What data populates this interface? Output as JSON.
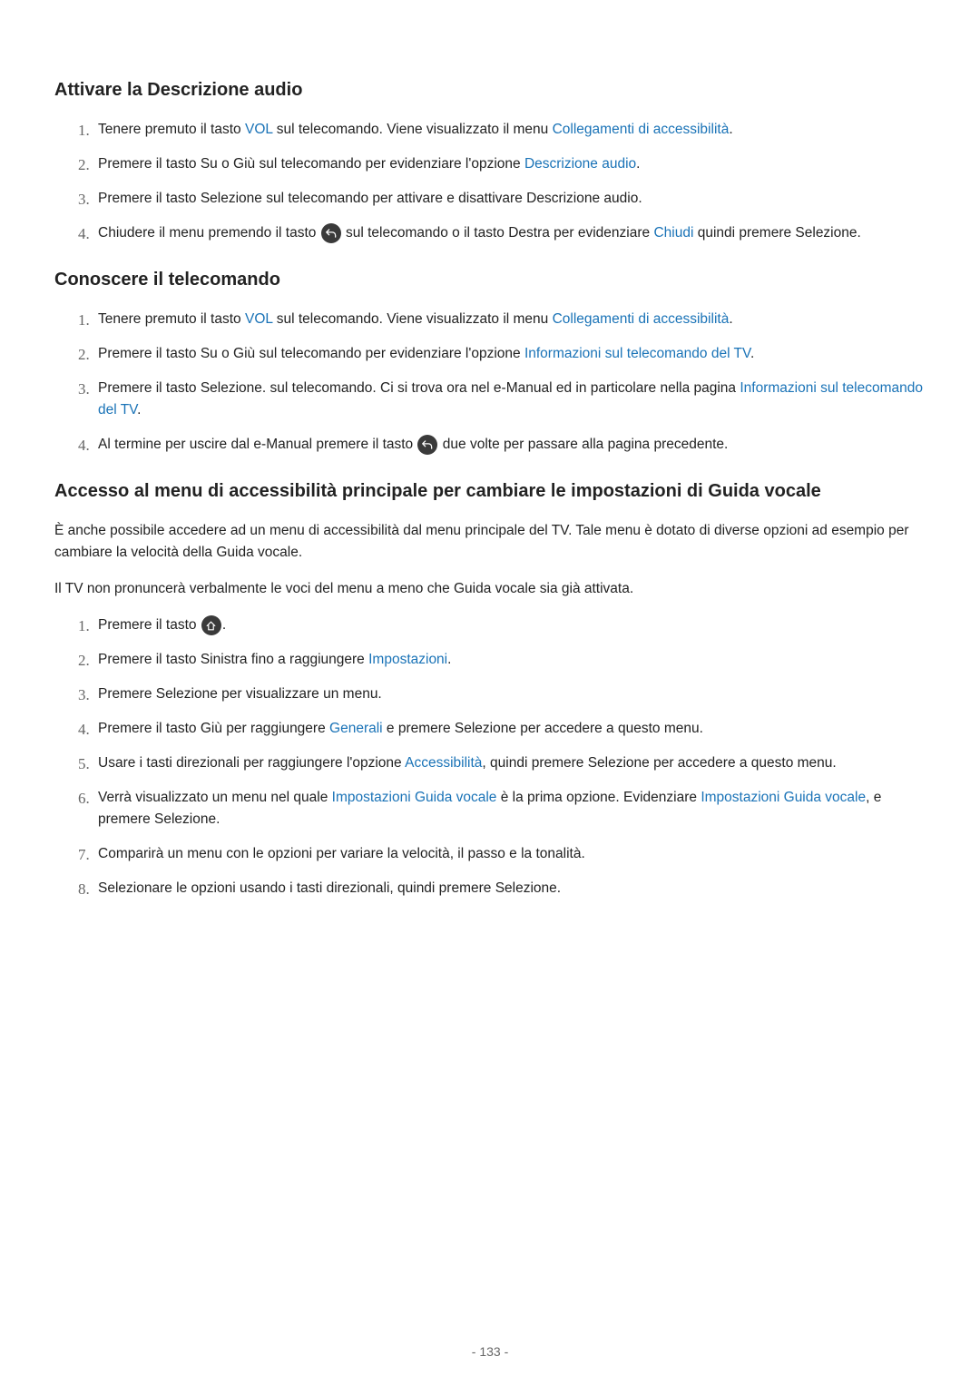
{
  "section1": {
    "title": "Attivare la Descrizione audio",
    "items": [
      {
        "p1a": "Tenere premuto il tasto ",
        "k1": "VOL",
        "p1b": " sul telecomando. Viene visualizzato il menu ",
        "k2": "Collegamenti di accessibilità",
        "p1c": "."
      },
      {
        "p1a": "Premere il tasto Su o Giù sul telecomando per evidenziare l'opzione ",
        "k1": "Descrizione audio",
        "p1b": "."
      },
      {
        "p1a": "Premere il tasto Selezione sul telecomando per attivare e disattivare Descrizione audio."
      },
      {
        "p1a": "Chiudere il menu premendo il tasto ",
        "icon": "back",
        "p1b": " sul telecomando o il tasto Destra per evidenziare ",
        "k1": "Chiudi",
        "p1c": " quindi premere Selezione."
      }
    ]
  },
  "section2": {
    "title": "Conoscere il telecomando",
    "items": [
      {
        "p1a": "Tenere premuto il tasto ",
        "k1": "VOL",
        "p1b": " sul telecomando. Viene visualizzato il menu ",
        "k2": "Collegamenti di accessibilità",
        "p1c": "."
      },
      {
        "p1a": "Premere il tasto Su o Giù sul telecomando per evidenziare l'opzione ",
        "k1": "Informazioni sul telecomando del TV",
        "p1b": "."
      },
      {
        "p1a": "Premere il tasto Selezione. sul telecomando. Ci si trova ora nel e-Manual ed in particolare nella pagina ",
        "k1": "Informazioni sul telecomando del TV",
        "p1b": "."
      },
      {
        "p1a": "Al termine per uscire dal e-Manual premere il tasto ",
        "icon": "back",
        "p1b": " due volte per passare alla pagina precedente."
      }
    ]
  },
  "section3": {
    "title": "Accesso al menu di accessibilità principale per cambiare le impostazioni di Guida vocale",
    "intro1": "È anche possibile accedere ad un menu di accessibilità dal menu principale del TV. Tale menu è dotato di diverse opzioni ad esempio per cambiare la velocità della Guida vocale.",
    "intro2": "Il TV non pronuncerà verbalmente le voci del menu a meno che Guida vocale sia già attivata.",
    "items": [
      {
        "p1a": "Premere il tasto ",
        "icon": "home",
        "p1b": "."
      },
      {
        "p1a": "Premere il tasto Sinistra fino a raggiungere ",
        "k1": "Impostazioni",
        "p1b": "."
      },
      {
        "p1a": "Premere Selezione per visualizzare un menu."
      },
      {
        "p1a": "Premere il tasto Giù per raggiungere ",
        "k1": "Generali",
        "p1b": " e premere Selezione per accedere a questo menu."
      },
      {
        "p1a": "Usare i tasti direzionali per raggiungere l'opzione ",
        "k1": "Accessibilità",
        "p1b": ", quindi premere Selezione per accedere a questo menu."
      },
      {
        "p1a": "Verrà visualizzato un menu nel quale ",
        "k1": "Impostazioni Guida vocale",
        "p1b": " è la prima opzione. Evidenziare ",
        "k2": "Impostazioni Guida vocale",
        "p1c": ", e premere Selezione."
      },
      {
        "p1a": "Comparirà un menu con le opzioni per variare la velocità, il passo e la tonalità."
      },
      {
        "p1a": "Selezionare le opzioni usando i tasti direzionali, quindi premere Selezione."
      }
    ]
  },
  "pageNumber": "- 133 -"
}
